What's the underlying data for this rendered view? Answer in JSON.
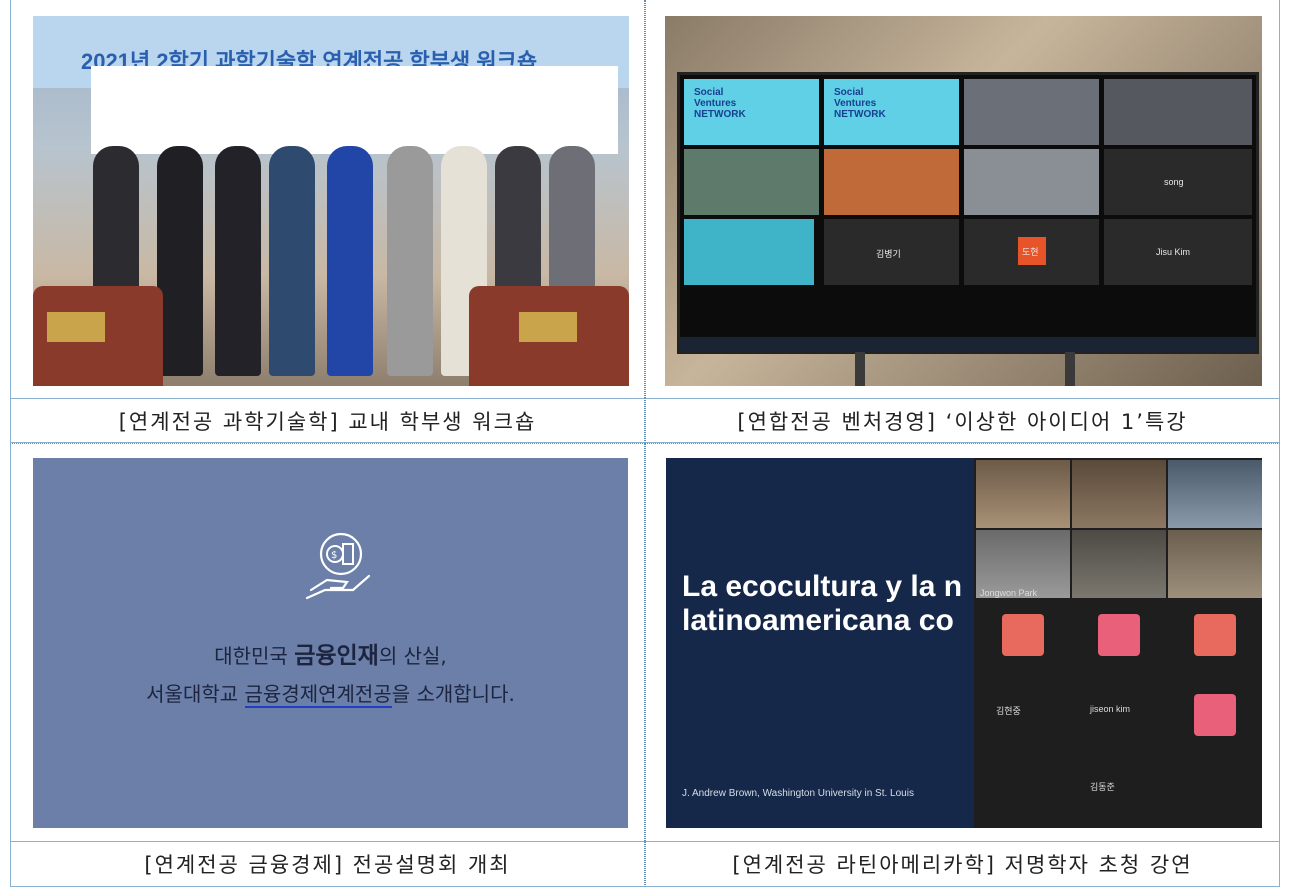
{
  "captions": {
    "c1": "[연계전공 과학기술학] 교내 학부생 워크숍",
    "c2": "[연합전공 벤처경영] ‘이상한 아이디어 1’특강",
    "c3": "[연계전공 금융경제] 전공설명회 개최",
    "c4": "[연계전공 라틴아메리카학] 저명학자 초청 강연"
  },
  "photo1": {
    "banner": "2021년 2학기 과학기술학 연계전공 학부생 워크숍"
  },
  "photo2": {
    "logo_lines": [
      "Social",
      "Ventures",
      "NETWORK"
    ],
    "names": [
      "김병기",
      "Jisu Kim",
      "song"
    ],
    "orange_label": "도현"
  },
  "photo3": {
    "line1_pre": "대한민국 ",
    "line1_em": "금융인재",
    "line1_post": "의 산실,",
    "line2_pre": "서울대학교 ",
    "line2_u": "금융경제연계전공",
    "line2_post": "을 소개합니다."
  },
  "photo4": {
    "title_line1": "La ecocultura y la n",
    "title_line2": "latinoamericana co",
    "author": "J. Andrew Brown, Washington University in St. Louis",
    "names": [
      "Jongwon Park",
      "김현중",
      "jiseon kim",
      "김동준"
    ]
  },
  "colors": {
    "border": "#8ab1cf",
    "accent": "#1f3fbf",
    "orange": "#e8542a",
    "avatar": "#e86a5e",
    "avatar_pink": "#e8607a"
  }
}
